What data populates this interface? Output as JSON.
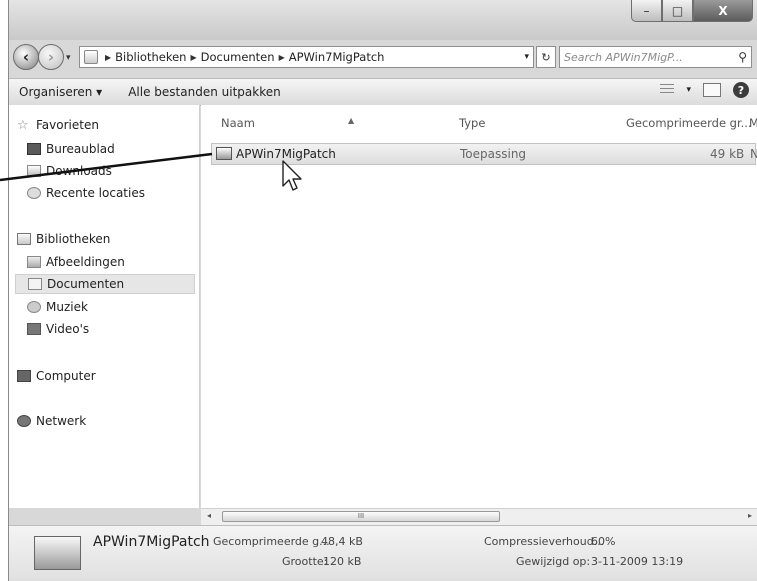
{
  "window": {
    "controls": {
      "minimize": "–",
      "maximize": "□",
      "close": "X"
    }
  },
  "nav": {
    "back_icon": "arrow-left-icon",
    "forward_icon": "arrow-right-icon",
    "dropdown": "▾"
  },
  "address": {
    "crumbs": [
      "Bibliotheken",
      "Documenten",
      "APWin7MigPatch"
    ],
    "search_placeholder": "Search APWin7MigP..."
  },
  "toolbar": {
    "organize": "Organiseren ▾",
    "extract_all": "Alle bestanden uitpakken"
  },
  "sidebar": {
    "items": [
      {
        "label": "Favorieten",
        "icon": "star-icon"
      },
      {
        "label": "Bureaublad",
        "icon": "desktop-icon"
      },
      {
        "label": "Downloads",
        "icon": "downloads-icon"
      },
      {
        "label": "Recente locaties",
        "icon": "recent-places-icon"
      },
      {
        "label": "Bibliotheken",
        "icon": "libraries-icon"
      },
      {
        "label": "Afbeeldingen",
        "icon": "pictures-icon"
      },
      {
        "label": "Documenten",
        "icon": "documents-icon",
        "selected": true
      },
      {
        "label": "Muziek",
        "icon": "music-icon"
      },
      {
        "label": "Video's",
        "icon": "videos-icon"
      },
      {
        "label": "Computer",
        "icon": "computer-icon"
      },
      {
        "label": "Netwerk",
        "icon": "network-icon"
      }
    ]
  },
  "table": {
    "columns": [
      "Naam",
      "Type",
      "Gecomprimeerde gr...",
      "M"
    ],
    "rows": [
      {
        "name": "APWin7MigPatch",
        "type": "Toepassing",
        "size": "49 kB",
        "extra": "N"
      }
    ]
  },
  "scrollbar": {
    "left": "◂",
    "right": "▸",
    "grip": "III"
  },
  "details": {
    "name": "APWin7MigPatch",
    "compressed_label": "Gecomprimeerde g...",
    "compressed_value": "48,4 kB",
    "size_label": "Grootte:",
    "size_value": "120 kB",
    "ratio_label": "Compressieverhoud...",
    "ratio_value": "60%",
    "modified_label": "Gewijzigd op:",
    "modified_value": "3-11-2009 13:19"
  }
}
